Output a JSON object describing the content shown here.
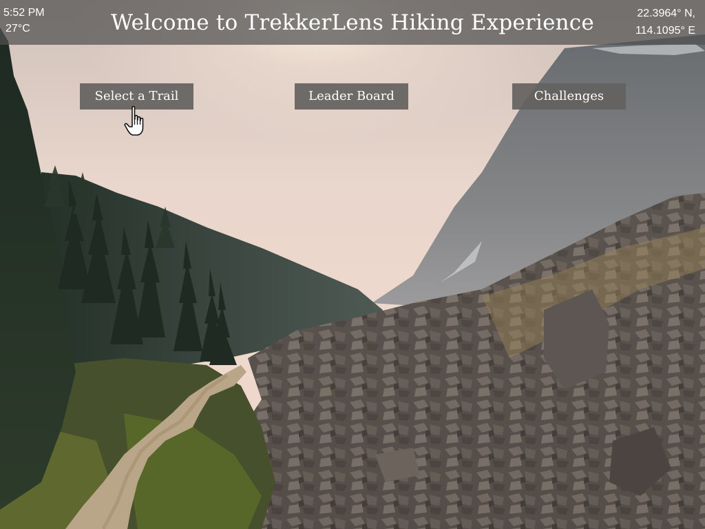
{
  "status": {
    "time": "5:52 PM",
    "temperature": "27°C",
    "latitude": "22.3964° N,",
    "longitude": "114.1095° E"
  },
  "header": {
    "title": "Welcome to TrekkerLens Hiking Experience"
  },
  "nav": {
    "select_trail": "Select a Trail",
    "leader_board": "Leader Board",
    "challenges": "Challenges"
  },
  "background": {
    "scene": "mountain valley hiking trail with scree slope and pine forest",
    "colors": {
      "sky": "#e8d2c6",
      "mountain": "#6f7479",
      "forest": "#2c3a30",
      "rocks": "#5e5450",
      "trail": "#b9a587"
    }
  },
  "cursor": {
    "icon": "hand-pointer-icon"
  }
}
